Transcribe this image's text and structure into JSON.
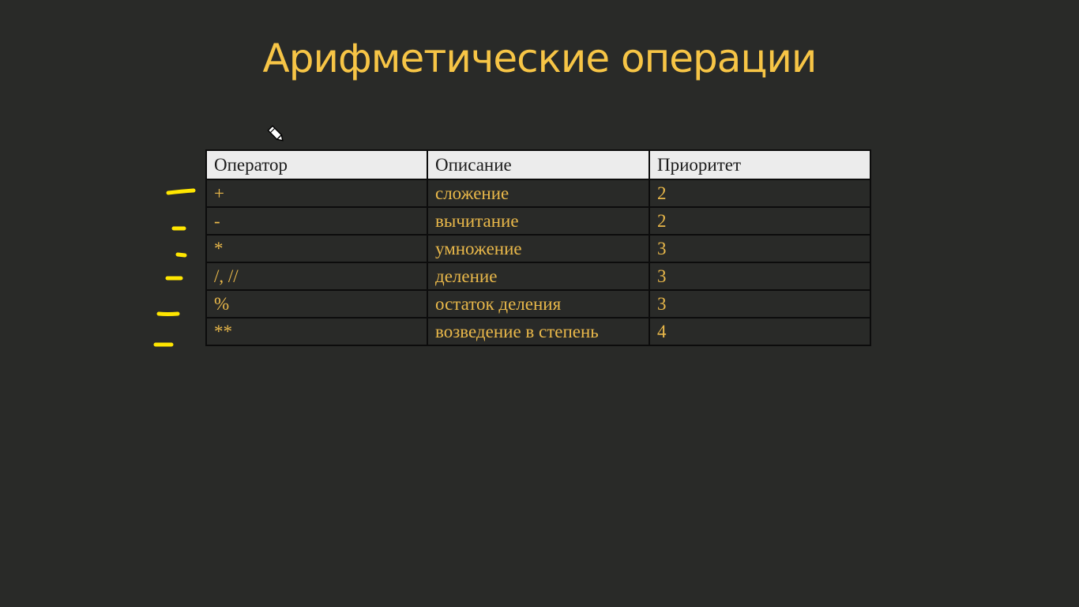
{
  "slide": {
    "title": "Арифметические операции"
  },
  "table": {
    "headers": [
      "Оператор",
      "Описание",
      "Приоритет"
    ],
    "rows": [
      {
        "operator": "+",
        "description": "сложение",
        "priority": "2"
      },
      {
        "operator": "-",
        "description": "вычитание",
        "priority": "2"
      },
      {
        "operator": "*",
        "description": "умножение",
        "priority": "3"
      },
      {
        "operator": "/, //",
        "description": "деление",
        "priority": "3"
      },
      {
        "operator": "%",
        "description": "остаток деления",
        "priority": "3"
      },
      {
        "operator": "**",
        "description": "возведение в степень",
        "priority": "4"
      }
    ]
  },
  "colors": {
    "background": "#292a28",
    "accent": "#f7c546",
    "cell_text": "#e9b84a",
    "header_bg": "#ececec",
    "annotation": "#ffe600"
  },
  "icons": {
    "cursor": "pen-cursor-icon"
  }
}
